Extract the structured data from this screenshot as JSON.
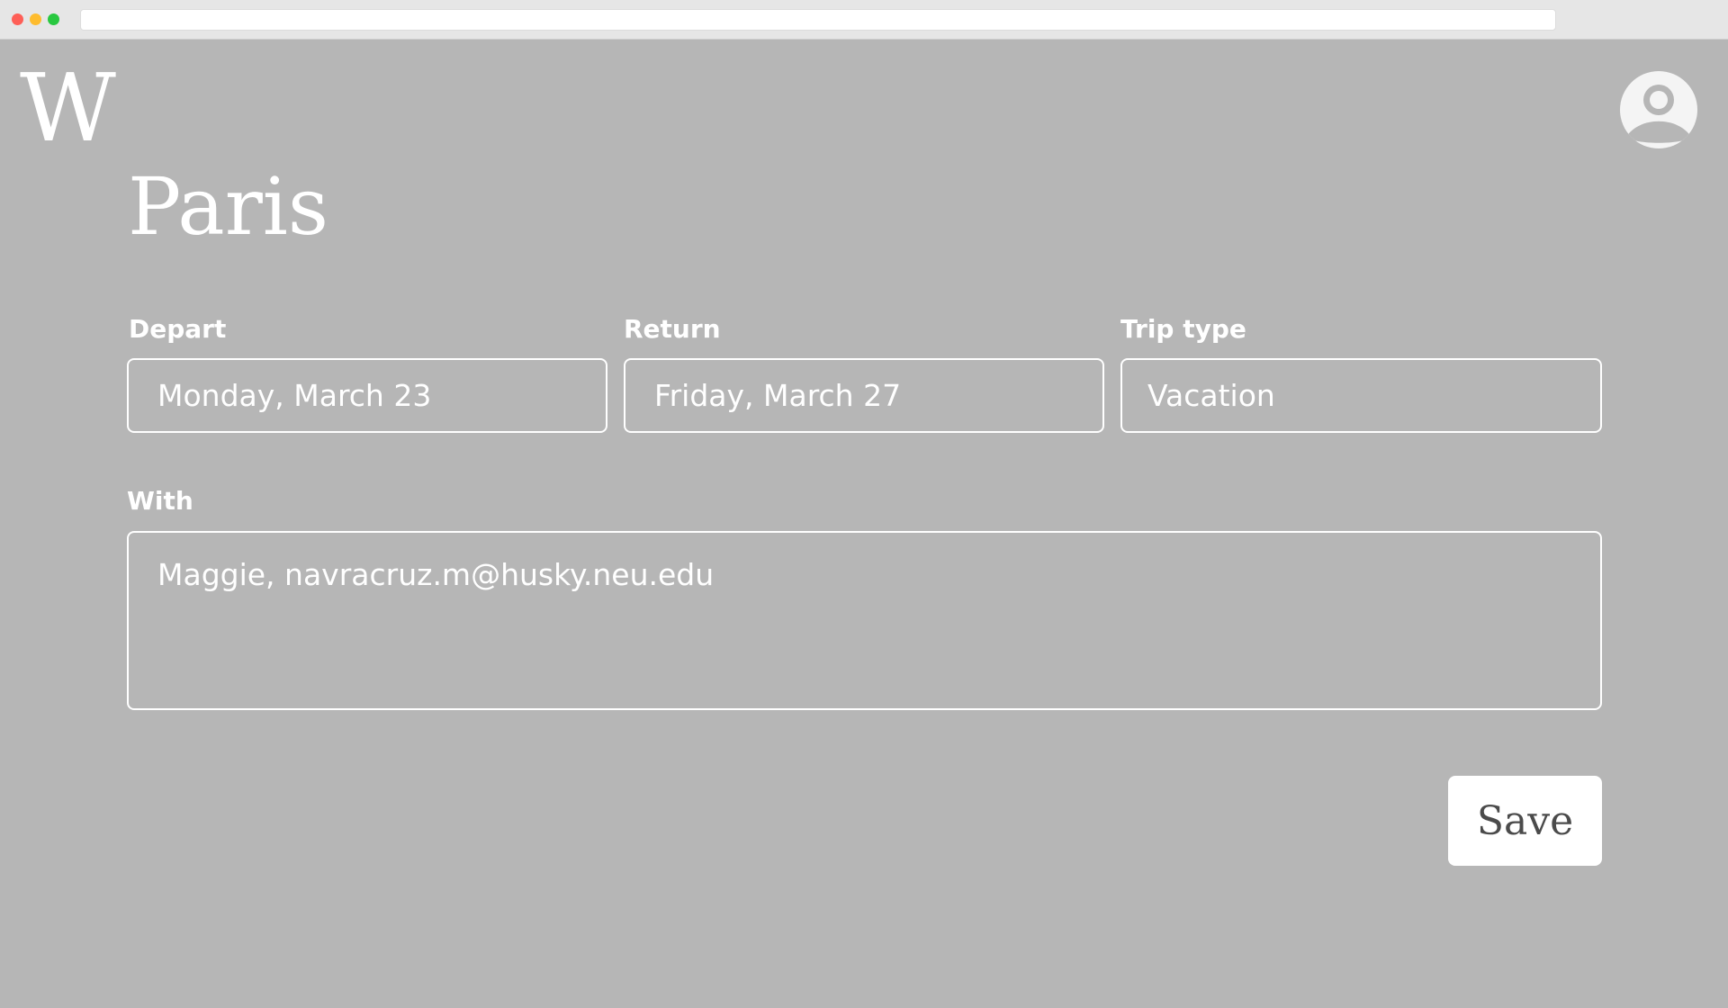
{
  "app": {
    "logo_text": "W"
  },
  "page": {
    "title": "Paris"
  },
  "form": {
    "depart": {
      "label": "Depart",
      "value": "Monday, March 23"
    },
    "return": {
      "label": "Return",
      "value": "Friday, March 27"
    },
    "trip_type": {
      "label": "Trip type",
      "value": "Vacation"
    },
    "with": {
      "label": "With",
      "value": "Maggie, navracruz.m@husky.neu.edu"
    }
  },
  "actions": {
    "save_label": "Save"
  },
  "icons": {
    "profile": "user-circle-icon"
  },
  "colors": {
    "background": "#b6b6b6",
    "foreground": "#ffffff",
    "button_text": "#4b4b4b"
  }
}
